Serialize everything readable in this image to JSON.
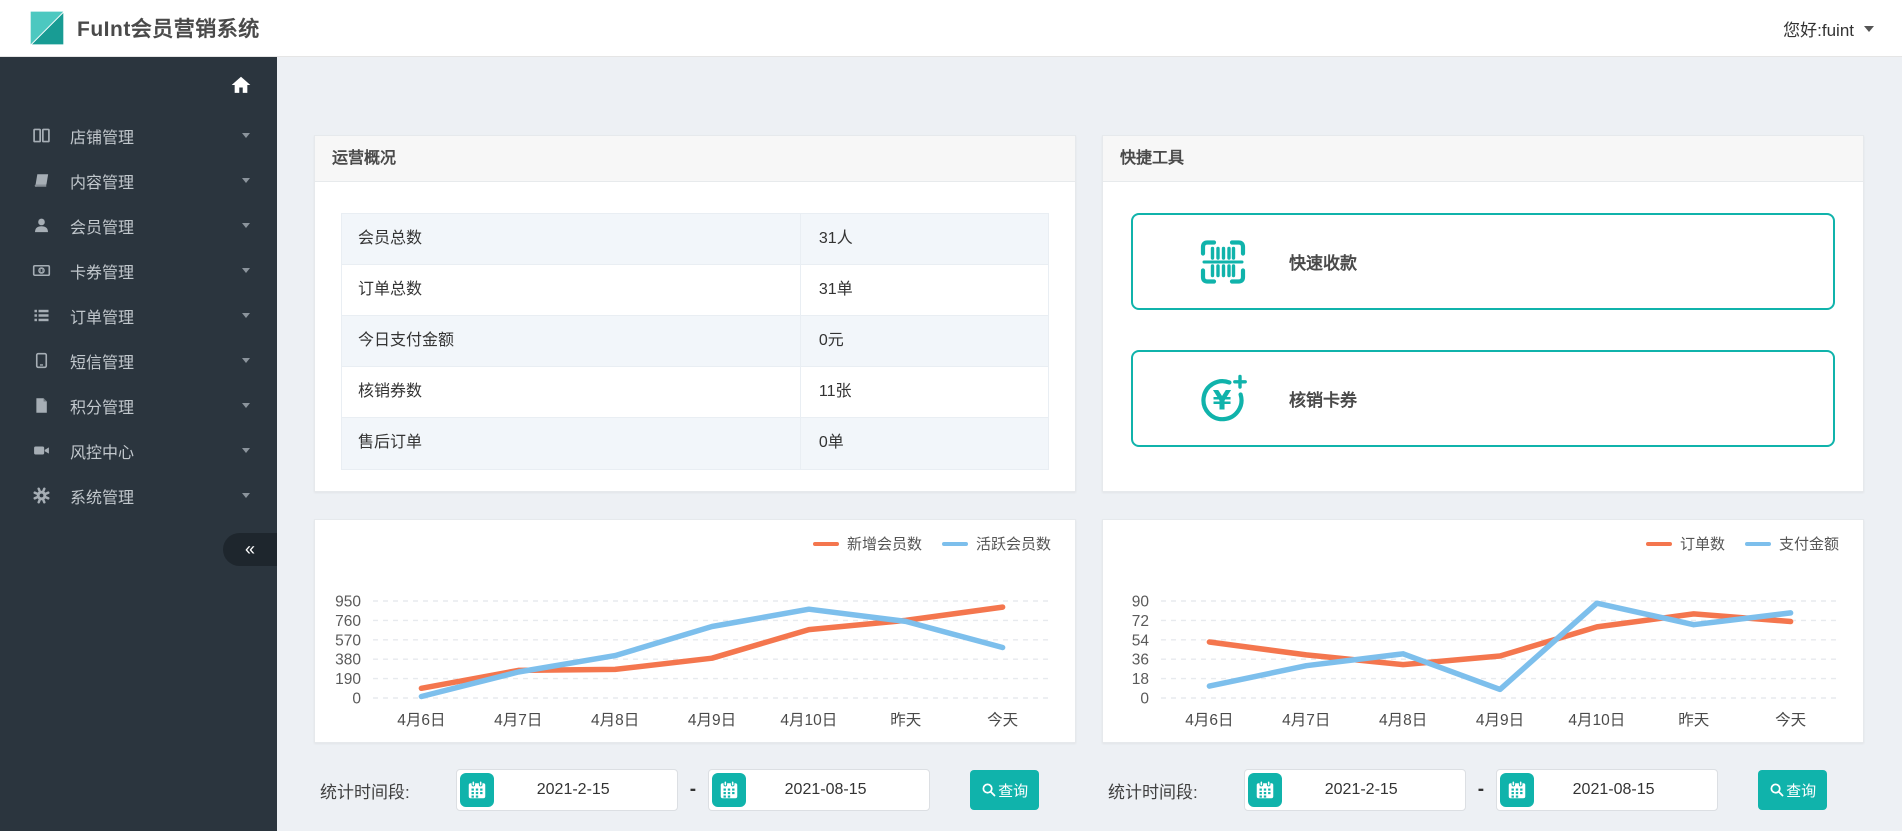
{
  "header": {
    "app_title": "FuInt会员营销系统",
    "user_greeting": "您好:fuint"
  },
  "sidebar": {
    "collapse_glyph": "«",
    "items": [
      {
        "label": "店铺管理",
        "icon": "columns"
      },
      {
        "label": "内容管理",
        "icon": "book"
      },
      {
        "label": "会员管理",
        "icon": "user"
      },
      {
        "label": "卡券管理",
        "icon": "money"
      },
      {
        "label": "订单管理",
        "icon": "list"
      },
      {
        "label": "短信管理",
        "icon": "tablet"
      },
      {
        "label": "积分管理",
        "icon": "file"
      },
      {
        "label": "风控中心",
        "icon": "video"
      },
      {
        "label": "系统管理",
        "icon": "gear"
      }
    ]
  },
  "overview": {
    "title": "运营概况",
    "rows": [
      {
        "label": "会员总数",
        "value": "31人"
      },
      {
        "label": "订单总数",
        "value": "31单"
      },
      {
        "label": "今日支付金额",
        "value": "0元"
      },
      {
        "label": "核销券数",
        "value": "11张"
      },
      {
        "label": "售后订单",
        "value": "0单"
      }
    ]
  },
  "quick_tools": {
    "title": "快捷工具",
    "buttons": [
      {
        "label": "快速收款",
        "icon": "barcode-scan"
      },
      {
        "label": "核销卡券",
        "icon": "yen-plus"
      }
    ]
  },
  "chart_data": [
    {
      "type": "line",
      "title": "",
      "x": [
        "4月6日",
        "4月7日",
        "4月8日",
        "4月9日",
        "4月10日",
        "昨天",
        "今天"
      ],
      "series": [
        {
          "name": "新增会员数",
          "color": "#F4764E",
          "values": [
            95,
            270,
            280,
            390,
            670,
            760,
            890
          ]
        },
        {
          "name": "活跃会员数",
          "color": "#7DBFEC",
          "values": [
            15,
            255,
            415,
            700,
            870,
            750,
            495
          ]
        }
      ],
      "yticks": [
        0,
        190,
        380,
        570,
        760,
        950
      ],
      "ylim": [
        0,
        950
      ],
      "legend_position": "top-right",
      "grid": "dashed-horizontal"
    },
    {
      "type": "line",
      "title": "",
      "x": [
        "4月6日",
        "4月7日",
        "4月8日",
        "4月9日",
        "4月10日",
        "昨天",
        "今天"
      ],
      "series": [
        {
          "name": "订单数",
          "color": "#F4764E",
          "values": [
            52,
            40,
            31,
            39,
            66,
            78,
            71
          ]
        },
        {
          "name": "支付金额",
          "color": "#7DBFEC",
          "values": [
            11,
            30,
            41,
            8,
            88,
            68,
            79
          ]
        }
      ],
      "yticks": [
        0,
        18,
        36,
        54,
        72,
        90
      ],
      "ylim": [
        0,
        90
      ],
      "legend_position": "top-right",
      "grid": "dashed-horizontal"
    }
  ],
  "filters": {
    "label": "统计时间段:",
    "start_date": "2021-2-15",
    "separator": "-",
    "end_date": "2021-08-15",
    "query_label": "查询"
  },
  "colors": {
    "accent_teal": "#10B3AB",
    "sidebar_bg": "#2B353E",
    "line_orange": "#F4764E",
    "line_blue": "#7DBFEC"
  }
}
